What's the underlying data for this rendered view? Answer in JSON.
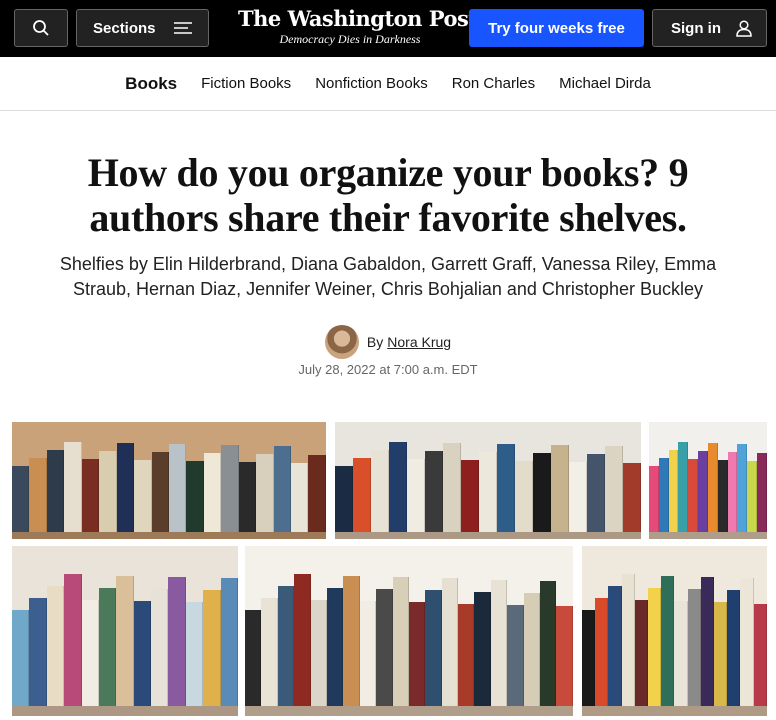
{
  "header": {
    "sections_label": "Sections",
    "logo_name": "The Washington Post",
    "logo_tagline": "Democracy Dies in Darkness",
    "subscribe_label": "Try four weeks free",
    "signin_label": "Sign in",
    "colors": {
      "bar": "#000000",
      "subscribe": "#1955ff"
    }
  },
  "nav": {
    "current": "Books",
    "items": [
      "Fiction Books",
      "Nonfiction Books",
      "Ron Charles",
      "Michael Dirda"
    ]
  },
  "article": {
    "headline": "How do you organize your books? 9 authors share their favorite shelves.",
    "subheadline": "Shelfies by Elin Hilderbrand, Diana Gabaldon, Garrett Graff, Vanessa Riley, Emma Straub, Hernan Diaz, Jennifer Weiner, Chris Bohjalian and Christopher Buckley",
    "by_prefix": "By",
    "author": "Nora Krug",
    "date": "July 28, 2022 at 7:00 a.m. EDT"
  },
  "collage": {
    "photos": [
      {
        "name": "shelf-photo-1",
        "bg": "#c9a27a",
        "books": [
          "#3a4a5c",
          "#c98f52",
          "#2d3b4a",
          "#e6dfcf",
          "#7a2e22",
          "#d9cdb0",
          "#1f2f55",
          "#e0d6be",
          "#5a3d2b",
          "#b8c2c8",
          "#213a2e",
          "#efe8d6",
          "#8a8f94",
          "#2a2a2a",
          "#d8d0bc",
          "#4d6f8f",
          "#e9e4d8",
          "#6b2a1e"
        ]
      },
      {
        "name": "shelf-photo-2",
        "bg": "#e8e4de",
        "books": [
          "#1c2b44",
          "#d84f2a",
          "#e7e2d6",
          "#233d6b",
          "#f0ece2",
          "#3a3a3a",
          "#d9d2c0",
          "#8e1f1f",
          "#ece8dc",
          "#2f5d8a",
          "#e3dccb",
          "#1a1a1a",
          "#c7b28e",
          "#f2efe6",
          "#44546a",
          "#dcd4c2",
          "#a33b2a"
        ]
      },
      {
        "name": "shelf-photo-3",
        "bg": "#f2f0ec",
        "books": [
          "#e64a7a",
          "#2f79b8",
          "#f2d24a",
          "#3aa0a8",
          "#d94a3a",
          "#6a3fa0",
          "#e98a2c",
          "#2a2a2a",
          "#f07ab0",
          "#4fa3d8",
          "#c8d84a",
          "#8a2a5a"
        ]
      },
      {
        "name": "shelf-photo-4",
        "bg": "#e9e3d9",
        "books": [
          "#6fa8c8",
          "#3c5f8f",
          "#e8dcc4",
          "#b84a7a",
          "#f2ede2",
          "#4a7a5a",
          "#d9c09a",
          "#2a4a7a",
          "#e6e2d8",
          "#8a5aa0",
          "#c8d8e0",
          "#e0b04a",
          "#5a8ab8"
        ]
      },
      {
        "name": "shelf-photo-5",
        "bg": "#f4f1ea",
        "books": [
          "#2a2a2a",
          "#e9e3d6",
          "#3b5a7a",
          "#8e2a22",
          "#dcd6c8",
          "#1f3a5a",
          "#c98f52",
          "#f1ede4",
          "#4a4a4a",
          "#d8cfb8",
          "#7a2a2a",
          "#2f4f6f",
          "#e6e0d2",
          "#a83a2a",
          "#1a2a3a",
          "#e8e2d4",
          "#5a6a7a",
          "#d6cdb6",
          "#2a3a2a",
          "#c84a3a"
        ]
      },
      {
        "name": "shelf-photo-6",
        "bg": "#efe9dd",
        "books": [
          "#1a1a1a",
          "#d84a2a",
          "#2a4a7a",
          "#e8e2d2",
          "#6a2a2a",
          "#f2d24a",
          "#2f6f5a",
          "#e9e4d8",
          "#8a8a8a",
          "#3a2a5a",
          "#d9b84a",
          "#1f3f6f",
          "#ece6d8",
          "#b83a4a"
        ]
      }
    ]
  }
}
